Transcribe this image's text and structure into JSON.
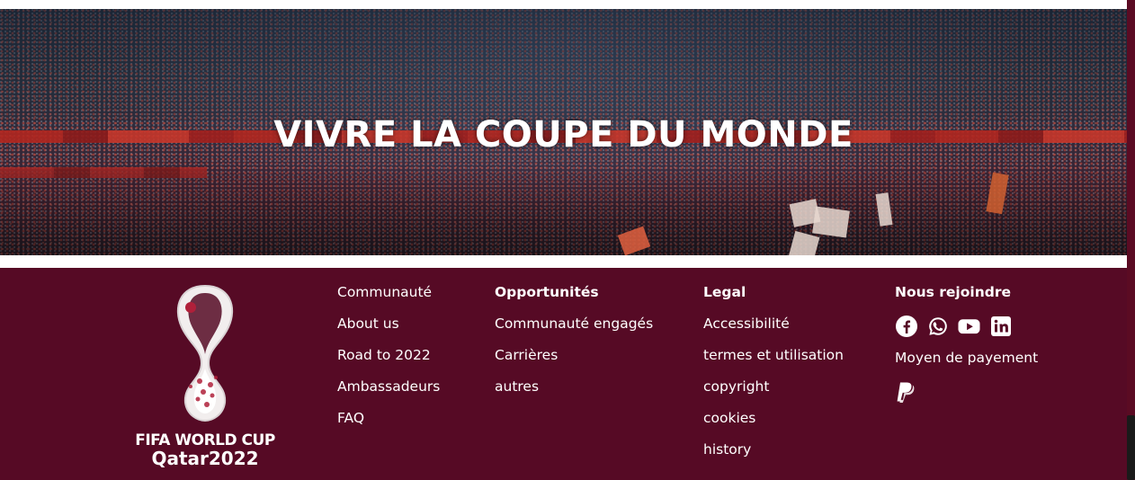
{
  "hero": {
    "title": "VIVRE LA COUPE DU MONDE"
  },
  "logo": {
    "line1": "FIFA WORLD CUP",
    "line2": "Qatar2022"
  },
  "footer": {
    "col1": {
      "items": [
        "Communauté",
        "About us",
        "Road to 2022",
        "Ambassadeurs",
        "FAQ"
      ]
    },
    "col2": {
      "heading": "Opportunités",
      "items": [
        "Communauté engagés",
        "Carrières",
        "autres"
      ]
    },
    "col3": {
      "heading": "Legal",
      "items": [
        "Accessibilité",
        "termes et utilisation",
        "copyright",
        "cookies",
        "history"
      ]
    },
    "col4": {
      "heading": "Nous rejoindre",
      "social_icons": [
        "facebook-icon",
        "whatsapp-icon",
        "youtube-icon",
        "linkedin-icon"
      ],
      "payment_label": "Moyen de payement",
      "payment_icons": [
        "paypal-icon"
      ]
    }
  },
  "colors": {
    "footer_bg": "#560a25",
    "text": "#ffffff"
  }
}
